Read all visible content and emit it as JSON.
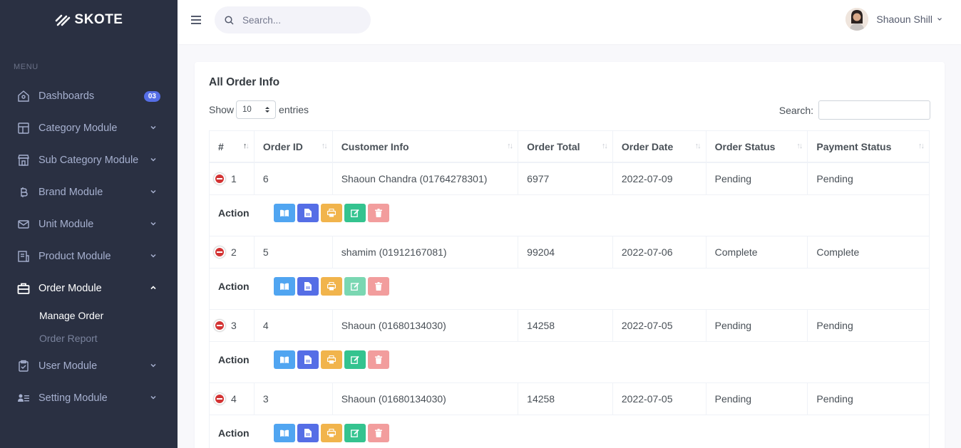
{
  "brand": {
    "name": "SKOTE"
  },
  "sidebar": {
    "menu_title": "MENU",
    "items": [
      {
        "label": "Dashboards",
        "icon": "home-icon",
        "badge": "03"
      },
      {
        "label": "Category Module",
        "icon": "layout-icon"
      },
      {
        "label": "Sub Category Module",
        "icon": "store-icon"
      },
      {
        "label": "Brand Module",
        "icon": "bitcoin-icon"
      },
      {
        "label": "Unit Module",
        "icon": "envelope-icon"
      },
      {
        "label": "Product Module",
        "icon": "receipt-icon"
      },
      {
        "label": "Order Module",
        "icon": "briefcase-icon"
      },
      {
        "label": "User Module",
        "icon": "clipboard-check-icon"
      },
      {
        "label": "Setting Module",
        "icon": "users-list-icon"
      }
    ],
    "submenu": [
      {
        "label": "Manage Order"
      },
      {
        "label": "Order Report"
      }
    ]
  },
  "topbar": {
    "search_placeholder": "Search...",
    "user_name": "Shaoun Shill"
  },
  "card": {
    "title": "All Order Info",
    "show_label": "Show",
    "entries_value": "10",
    "entries_label": "entries",
    "search_label": "Search:"
  },
  "table": {
    "headers": [
      "#",
      "Order ID",
      "Customer Info",
      "Order Total",
      "Order Date",
      "Order Status",
      "Payment Status"
    ],
    "rows": [
      {
        "num": "1",
        "order_id": "6",
        "customer": "Shaoun Chandra (01764278301)",
        "total": "6977",
        "date": "2022-07-09",
        "order_status": "Pending",
        "payment_status": "Pending"
      },
      {
        "num": "2",
        "order_id": "5",
        "customer": "shamim (01912167081)",
        "total": "99204",
        "date": "2022-07-06",
        "order_status": "Complete",
        "payment_status": "Complete"
      },
      {
        "num": "3",
        "order_id": "4",
        "customer": "Shaoun (01680134030)",
        "total": "14258",
        "date": "2022-07-05",
        "order_status": "Pending",
        "payment_status": "Pending"
      },
      {
        "num": "4",
        "order_id": "3",
        "customer": "Shaoun (01680134030)",
        "total": "14258",
        "date": "2022-07-05",
        "order_status": "Pending",
        "payment_status": "Pending"
      }
    ],
    "action_label": "Action"
  },
  "colors": {
    "sidebar_bg": "#2a3042",
    "primary": "#556ee6",
    "info": "#50a5f1",
    "warning": "#f1b44c",
    "success": "#34c38f",
    "danger_light": "#f29d9d"
  }
}
